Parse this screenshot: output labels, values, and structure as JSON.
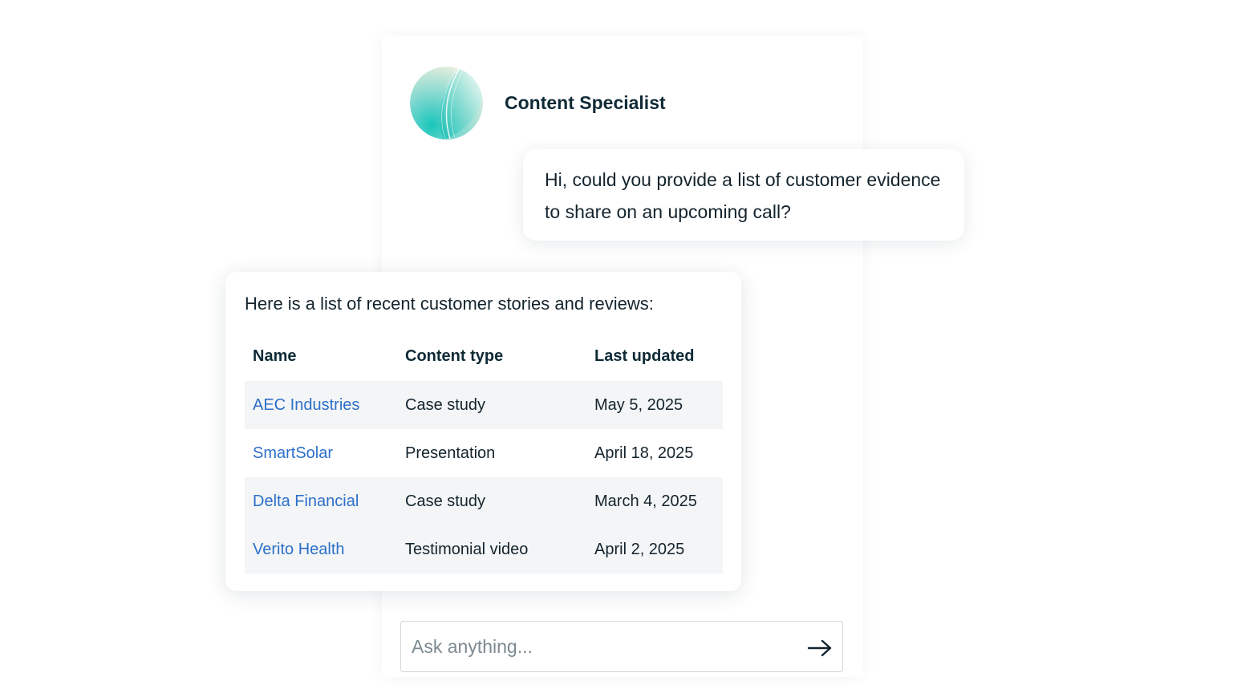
{
  "agent": {
    "name": "Content Specialist",
    "avatar_icon": "agent-orb-icon"
  },
  "user_message": {
    "text": "Hi, could you provide a list of customer evidence to share on an upcoming call?"
  },
  "reply": {
    "intro": "Here is a list of recent customer stories and reviews:",
    "columns": [
      "Name",
      "Content type",
      "Last updated"
    ],
    "rows": [
      {
        "name": "AEC Industries",
        "type": "Case study",
        "updated": "May 5, 2025"
      },
      {
        "name": "SmartSolar",
        "type": "Presentation",
        "updated": "April 18, 2025"
      },
      {
        "name": "Delta Financial",
        "type": "Case study",
        "updated": "March 4, 2025"
      },
      {
        "name": "Verito Health",
        "type": "Testimonial video",
        "updated": "April 2, 2025"
      }
    ]
  },
  "composer": {
    "placeholder": "Ask anything...",
    "send_icon": "arrow-right-icon"
  },
  "colors": {
    "link": "#2d6fcb",
    "heading_text": "#0f2a36",
    "row_shade": "#f3f5f6",
    "avatar_teal": "#17c3b8"
  }
}
